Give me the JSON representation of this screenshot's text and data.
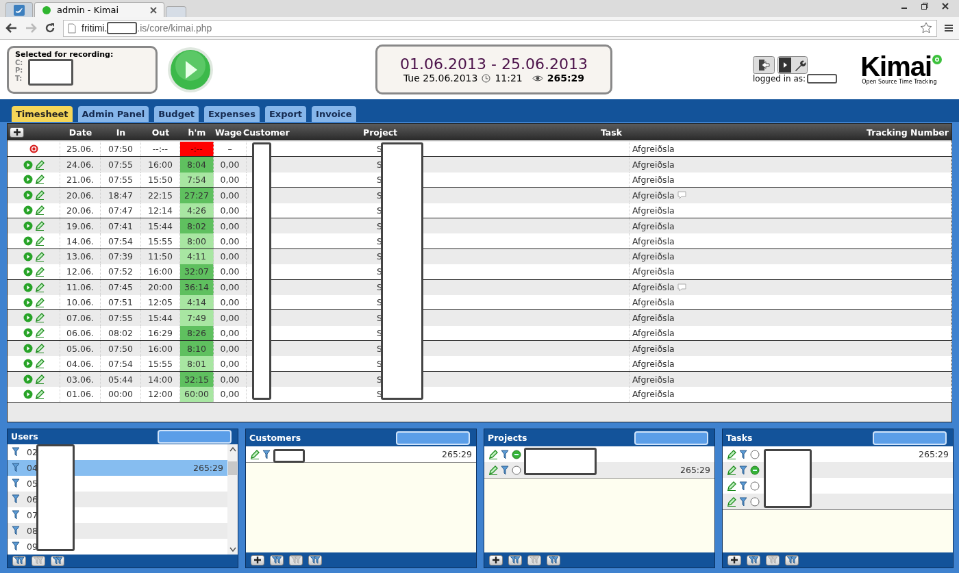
{
  "browser": {
    "tabs": [
      {
        "kind": "icon",
        "selected": false
      },
      {
        "kind": "page",
        "title": "admin - Kimai",
        "selected": true
      },
      {
        "kind": "new",
        "selected": false
      }
    ],
    "url_start": "fritimi.",
    "url_end": ".is/core/kimai.php"
  },
  "recording": {
    "title": "Selected for recording:",
    "labels": [
      "C:",
      "P:",
      "T:"
    ]
  },
  "range": {
    "dates": "01.06.2013 - 25.06.2013",
    "today": "Tue 25.06.2013",
    "time": "11:21",
    "total": "265:29"
  },
  "user": {
    "logged_in_label": "logged in as:"
  },
  "logo": {
    "name": "Kimai",
    "tagline": "Open Source Time Tracking"
  },
  "tabs": [
    {
      "label": "Timesheet",
      "selected": true
    },
    {
      "label": "Admin Panel",
      "selected": false
    },
    {
      "label": "Budget",
      "selected": false
    },
    {
      "label": "Expenses",
      "selected": false
    },
    {
      "label": "Export",
      "selected": false
    },
    {
      "label": "Invoice",
      "selected": false
    }
  ],
  "table": {
    "columns": [
      "Date",
      "In",
      "Out",
      "h'm",
      "Wage",
      "Customer",
      "Project",
      "Task",
      "Tracking Number"
    ],
    "rows": [
      {
        "kind": "running",
        "date": "25.06.",
        "in": "07:50",
        "out": "--:--",
        "hm": "-:--",
        "wage": "–",
        "project": "S",
        "task": "Afgreiðsla",
        "comment": false,
        "color": "#ff0000"
      },
      {
        "kind": "done",
        "date": "24.06.",
        "in": "07:55",
        "out": "16:00",
        "hm": "8:04",
        "wage": "0,00",
        "project": "S",
        "task": "Afgreiðsla",
        "comment": false,
        "color": "#5fc05f"
      },
      {
        "kind": "done",
        "date": "21.06.",
        "in": "07:55",
        "out": "15:50",
        "hm": "7:54",
        "wage": "0,00",
        "project": "S",
        "task": "Afgreiðsla",
        "comment": false,
        "color": "#a8e6a2"
      },
      {
        "kind": "done",
        "date": "20.06.",
        "in": "18:47",
        "out": "22:15",
        "hm": "27:27",
        "wage": "0,00",
        "project": "S",
        "task": "Afgreiðsla",
        "comment": true,
        "color": "#5fc05f"
      },
      {
        "kind": "done",
        "date": "20.06.",
        "in": "07:47",
        "out": "12:14",
        "hm": "4:26",
        "wage": "0,00",
        "project": "S",
        "task": "Afgreiðsla",
        "comment": false,
        "color": "#a8e6a2"
      },
      {
        "kind": "done",
        "date": "19.06.",
        "in": "07:41",
        "out": "15:44",
        "hm": "8:02",
        "wage": "0,00",
        "project": "S",
        "task": "Afgreiðsla",
        "comment": false,
        "color": "#5fc05f"
      },
      {
        "kind": "done",
        "date": "14.06.",
        "in": "07:54",
        "out": "15:55",
        "hm": "8:00",
        "wage": "0,00",
        "project": "S",
        "task": "Afgreiðsla",
        "comment": false,
        "color": "#a8e6a2"
      },
      {
        "kind": "done",
        "date": "13.06.",
        "in": "07:39",
        "out": "11:50",
        "hm": "4:11",
        "wage": "0,00",
        "project": "S",
        "task": "Afgreiðsla",
        "comment": false,
        "color": "#a8e6a2"
      },
      {
        "kind": "done",
        "date": "12.06.",
        "in": "07:52",
        "out": "16:00",
        "hm": "32:07",
        "wage": "0,00",
        "project": "S",
        "task": "Afgreiðsla",
        "comment": false,
        "color": "#5fc05f"
      },
      {
        "kind": "done",
        "date": "11.06.",
        "in": "07:45",
        "out": "20:00",
        "hm": "36:14",
        "wage": "0,00",
        "project": "S",
        "task": "Afgreiðsla",
        "comment": true,
        "color": "#5fc05f"
      },
      {
        "kind": "done",
        "date": "10.06.",
        "in": "07:51",
        "out": "12:05",
        "hm": "4:14",
        "wage": "0,00",
        "project": "S",
        "task": "Afgreiðsla",
        "comment": false,
        "color": "#a8e6a2"
      },
      {
        "kind": "done",
        "date": "07.06.",
        "in": "07:55",
        "out": "15:44",
        "hm": "7:49",
        "wage": "0,00",
        "project": "S",
        "task": "Afgreiðsla",
        "comment": false,
        "color": "#a8e6a2"
      },
      {
        "kind": "done",
        "date": "06.06.",
        "in": "08:02",
        "out": "16:29",
        "hm": "8:26",
        "wage": "0,00",
        "project": "S",
        "task": "Afgreiðsla",
        "comment": false,
        "color": "#5fc05f"
      },
      {
        "kind": "done",
        "date": "05.06.",
        "in": "07:50",
        "out": "16:00",
        "hm": "8:10",
        "wage": "0,00",
        "project": "S",
        "task": "Afgreiðsla",
        "comment": false,
        "color": "#5fc05f"
      },
      {
        "kind": "done",
        "date": "04.06.",
        "in": "07:54",
        "out": "15:55",
        "hm": "8:01",
        "wage": "0,00",
        "project": "S",
        "task": "Afgreiðsla",
        "comment": false,
        "color": "#a8e6a2"
      },
      {
        "kind": "done",
        "date": "03.06.",
        "in": "05:44",
        "out": "14:00",
        "hm": "32:15",
        "wage": "0,00",
        "project": "S",
        "task": "Afgreiðsla",
        "comment": false,
        "color": "#5fc05f"
      },
      {
        "kind": "done",
        "date": "01.06.",
        "in": "00:00",
        "out": "12:00",
        "hm": "60:00",
        "wage": "0,00",
        "project": "S",
        "task": "Afgreiðsla",
        "comment": false,
        "color": "#a8e6a2"
      }
    ]
  },
  "panels": [
    {
      "kind": "users",
      "title": "Users",
      "items": [
        {
          "label": "02",
          "selected": false
        },
        {
          "label": "04",
          "time": "265:29",
          "selected": true
        },
        {
          "label": "05",
          "selected": false
        },
        {
          "label": "06",
          "selected": false
        },
        {
          "label": "07",
          "selected": false
        },
        {
          "label": "08",
          "selected": false
        },
        {
          "label": "09",
          "selected": false
        }
      ],
      "buttons": [
        {
          "kind": "filter",
          "disabled": false
        },
        {
          "kind": "filter",
          "disabled": true
        },
        {
          "kind": "filter",
          "disabled": false
        }
      ]
    },
    {
      "kind": "customers",
      "title": "Customers",
      "items": [
        {
          "time": "265:29"
        }
      ],
      "buttons": [
        {
          "kind": "add",
          "disabled": false
        },
        {
          "kind": "filter",
          "disabled": false
        },
        {
          "kind": "filter",
          "disabled": true
        },
        {
          "kind": "filter",
          "disabled": false
        }
      ]
    },
    {
      "kind": "projects",
      "title": "Projects",
      "items": [
        {
          "selected": true
        },
        {
          "time": "265:29",
          "selected": false
        }
      ],
      "buttons": [
        {
          "kind": "add",
          "disabled": false
        },
        {
          "kind": "filter",
          "disabled": false
        },
        {
          "kind": "filter",
          "disabled": true
        },
        {
          "kind": "filter",
          "disabled": false
        }
      ]
    },
    {
      "kind": "tasks",
      "title": "Tasks",
      "items": [
        {
          "time": "265:29",
          "selected": false
        },
        {
          "selected": true
        },
        {
          "selected": false
        },
        {
          "selected": false
        }
      ],
      "buttons": [
        {
          "kind": "add",
          "disabled": false
        },
        {
          "kind": "filter",
          "disabled": false
        },
        {
          "kind": "filter",
          "disabled": true
        },
        {
          "kind": "filter",
          "disabled": false
        }
      ]
    }
  ]
}
